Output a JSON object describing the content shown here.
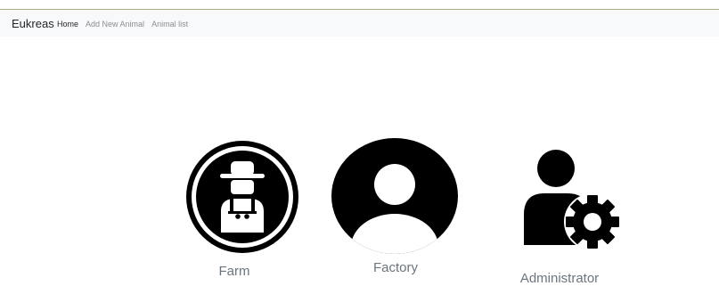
{
  "navbar": {
    "brand": "Eukreas",
    "links": [
      {
        "label": "Home",
        "active": true
      },
      {
        "label": "Add New Animal",
        "active": false
      },
      {
        "label": "Animal list",
        "active": false
      }
    ]
  },
  "roles": [
    {
      "label": "Farm",
      "icon": "farmer-icon"
    },
    {
      "label": "Factory",
      "icon": "user-profile-icon"
    },
    {
      "label": "Administrator",
      "icon": "admin-gear-icon"
    }
  ],
  "colors": {
    "navbar_bg": "#f8f9fa",
    "label": "#6c757d",
    "icon": "#000000"
  }
}
